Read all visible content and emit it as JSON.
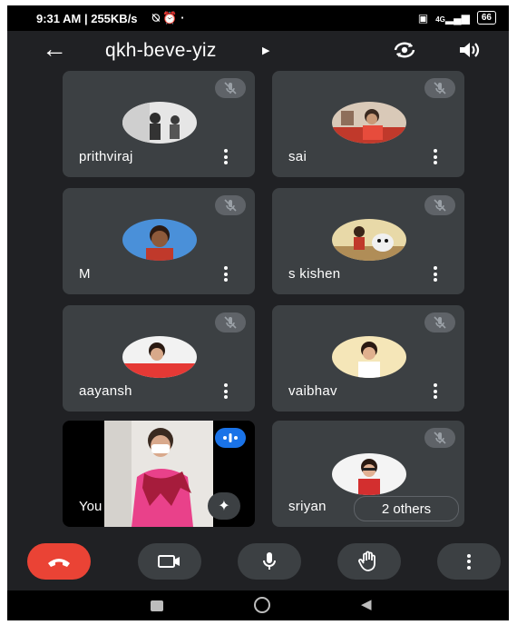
{
  "status": {
    "time": "9:31 AM | 255KB/s",
    "battery": "66",
    "network": "4G"
  },
  "meeting": {
    "code": "qkh-beve-yiz"
  },
  "participants": [
    {
      "name": "prithviraj"
    },
    {
      "name": "sai"
    },
    {
      "name": "M"
    },
    {
      "name": "s kishen"
    },
    {
      "name": "aayansh"
    },
    {
      "name": "vaibhav"
    }
  ],
  "self_tile": {
    "label": "You"
  },
  "last_tile": {
    "name": "sriyan",
    "others": "2 others"
  },
  "icons": {
    "back": "arrow-left-icon",
    "switch_camera": "switch-camera-icon",
    "speaker": "speaker-icon",
    "mic_off": "mic-off-icon",
    "more": "more-vert-icon",
    "end_call": "end-call-icon",
    "camera": "videocam-icon",
    "mic": "mic-icon",
    "hand": "raise-hand-icon",
    "effects": "sparkle-icon"
  },
  "colors": {
    "background": "#202124",
    "tile": "#3c4043",
    "end_call": "#ea4335",
    "speaking": "#1a73e8"
  }
}
